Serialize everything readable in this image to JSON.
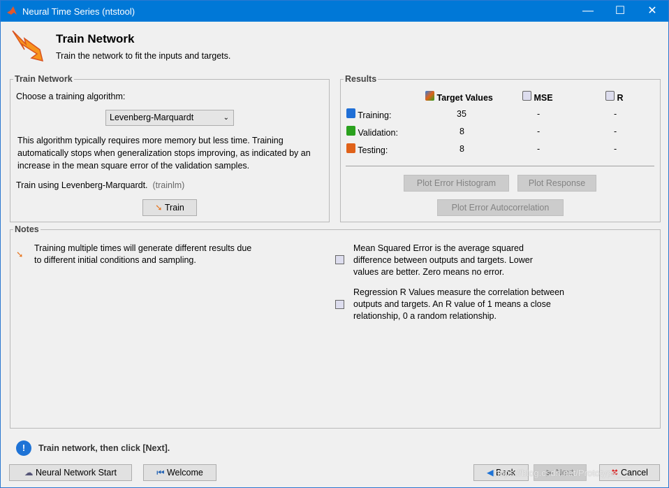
{
  "window": {
    "title": "Neural Time Series (ntstool)",
    "controls": [
      "—",
      "☐",
      "✕"
    ]
  },
  "header": {
    "title": "Train Network",
    "subtitle": "Train the network to fit the inputs and targets."
  },
  "train_panel": {
    "title": "Train Network",
    "choose_label": "Choose a training algorithm:",
    "algorithm": "Levenberg-Marquardt",
    "description": "This algorithm typically requires more memory but less time. Training automatically stops when generalization stops improving, as indicated by an increase in the mean square error of the validation samples.",
    "train_using": "Train using Levenberg-Marquardt.",
    "train_fn": "(trainlm)",
    "train_button": "Train"
  },
  "results": {
    "title": "Results",
    "columns": [
      "Target Values",
      "MSE",
      "R"
    ],
    "rows": [
      {
        "label": "Training:",
        "targets": "35",
        "mse": "-",
        "r": "-",
        "color": "#1f6fd6"
      },
      {
        "label": "Validation:",
        "targets": "8",
        "mse": "-",
        "r": "-",
        "color": "#2aa11e"
      },
      {
        "label": "Testing:",
        "targets": "8",
        "mse": "-",
        "r": "-",
        "color": "#e0621a"
      }
    ],
    "buttons": {
      "histogram": "Plot Error Histogram",
      "response": "Plot Response",
      "autocorr": "Plot Error Autocorrelation"
    }
  },
  "notes": {
    "title": "Notes",
    "note1": "Training multiple times will generate different results due to different initial conditions and sampling.",
    "note2": "Mean Squared Error is the average squared difference between outputs and targets. Lower values are better. Zero means no error.",
    "note3": "Regression R Values measure the correlation between outputs and targets. An R value of 1 means a close relationship, 0 a random relationship."
  },
  "status": "Train network, then click [Next].",
  "footer": {
    "start": "Neural Network Start",
    "welcome": "Welcome",
    "back": "Back",
    "next": "Next",
    "cancel": "Cancel"
  },
  "watermark": "https://blog.csdn.net/Prototype___"
}
